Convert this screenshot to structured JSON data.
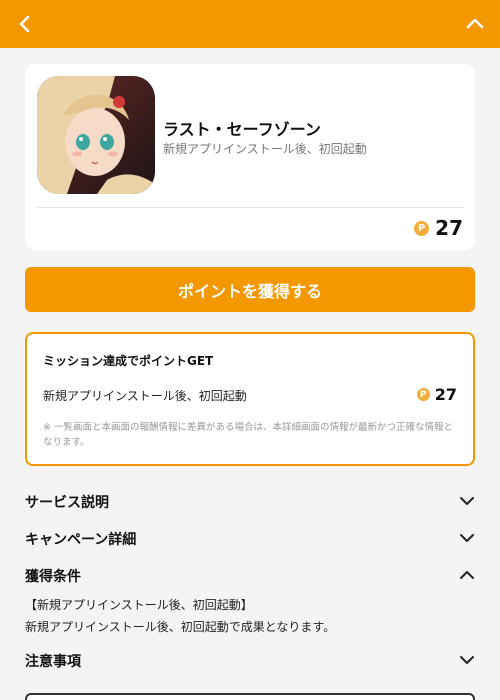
{
  "header": {
    "back_icon": "chevron-left-icon",
    "collapse_icon": "chevron-up-icon",
    "color": "#f39800"
  },
  "app": {
    "icon": "app-icon",
    "name": "ラスト・セーフゾーン",
    "subtitle": "新規アプリインストール後、初回起動",
    "coin_symbol": "P",
    "points": "27"
  },
  "cta": {
    "label": "ポイントを獲得する"
  },
  "mission": {
    "title": "ミッション達成でポイントGET",
    "item_label": "新規アプリインストール後、初回起動",
    "coin_symbol": "P",
    "item_points": "27",
    "note": "※ 一覧画面と本画面の報酬情報に差異がある場合は、本詳細画面の情報が最新かつ正確な情報となります。"
  },
  "sections": {
    "service": {
      "label": "サービス説明",
      "icon": "chevron-down-icon"
    },
    "campaign": {
      "label": "キャンペーン詳細",
      "icon": "chevron-down-icon"
    },
    "conditions": {
      "label": "獲得条件",
      "icon": "chevron-up-icon",
      "body_line1": "【新規アプリインストール後、初回起動】",
      "body_line2": "新規アプリインストール後、初回起動で成果となります。"
    },
    "notes": {
      "label": "注意事項",
      "icon": "chevron-down-icon"
    }
  },
  "colors": {
    "accent": "#f39800",
    "coin": "#f2ad3d",
    "background": "#f4f4f4"
  }
}
